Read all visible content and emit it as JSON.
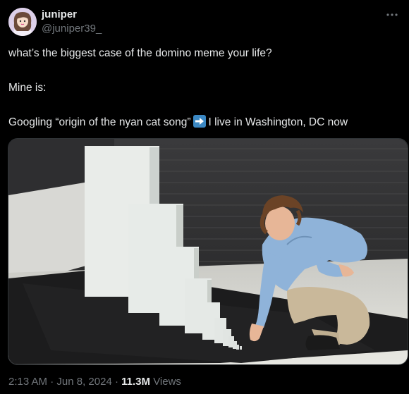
{
  "author": {
    "name": "juniper",
    "handle": "@juniper39_"
  },
  "menu_icon": "more-horizontal-icon",
  "post": {
    "line1": "what’s the biggest case of the domino meme your life?",
    "line2": "Mine is:",
    "line3_before": "Googling “origin of the nyan cat song”",
    "line3_emoji": "right-arrow-emoji",
    "line3_after": "I live in Washington, DC now"
  },
  "media": {
    "type": "photo",
    "subject": "domino-meme-image"
  },
  "meta": {
    "time": "2:13 AM",
    "sep1": "·",
    "date": "Jun 8, 2024",
    "sep2": "·",
    "views_count": "11.3M",
    "views_label": "Views"
  },
  "colors": {
    "background": "#000000",
    "text_primary": "#e7e9ea",
    "text_secondary": "#71767b",
    "emoji_blue": "#3b88c3"
  }
}
